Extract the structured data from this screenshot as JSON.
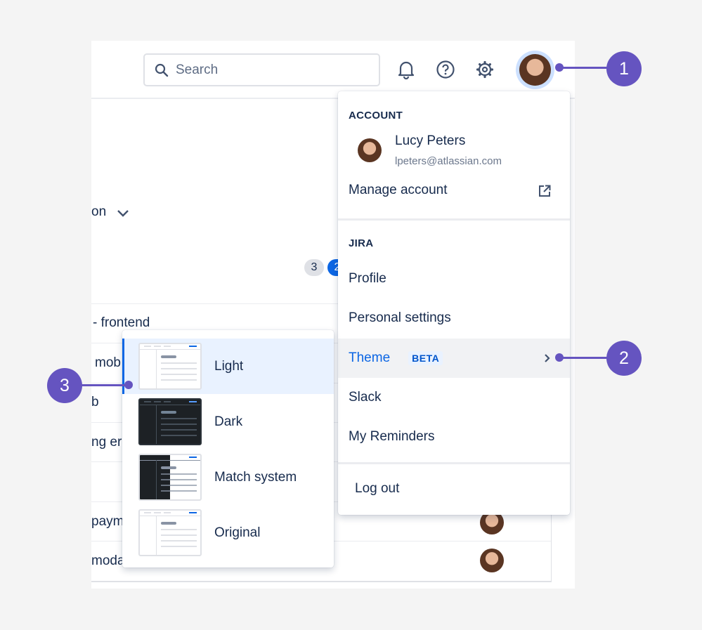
{
  "header": {
    "search_placeholder": "Search",
    "icons": [
      "search-icon",
      "bell-icon",
      "help-icon",
      "gear-icon",
      "avatar"
    ]
  },
  "background": {
    "dropdown_label_fragment": "on",
    "badges": [
      "3",
      "2"
    ],
    "rows": [
      "- frontend",
      "mob",
      "b",
      "ng er",
      "",
      "paym",
      "moda"
    ]
  },
  "account_menu": {
    "account_heading": "ACCOUNT",
    "user_name": "Lucy Peters",
    "user_email": "lpeters@atlassian.com",
    "manage_account": "Manage account",
    "jira_heading": "JIRA",
    "items": [
      {
        "label": "Profile"
      },
      {
        "label": "Personal settings"
      },
      {
        "label": "Theme",
        "badge": "BETA",
        "active": true
      },
      {
        "label": "Slack"
      },
      {
        "label": "My Reminders"
      }
    ],
    "logout": "Log out"
  },
  "theme_submenu": {
    "options": [
      {
        "label": "Light",
        "selected": true
      },
      {
        "label": "Dark"
      },
      {
        "label": "Match system"
      },
      {
        "label": "Original"
      }
    ]
  },
  "callouts": [
    "1",
    "2",
    "3"
  ],
  "colors": {
    "accent": "#0c66e4",
    "callout": "#6554c0",
    "selected_bg": "#e9f2ff",
    "hover_bg": "#f1f2f4"
  }
}
